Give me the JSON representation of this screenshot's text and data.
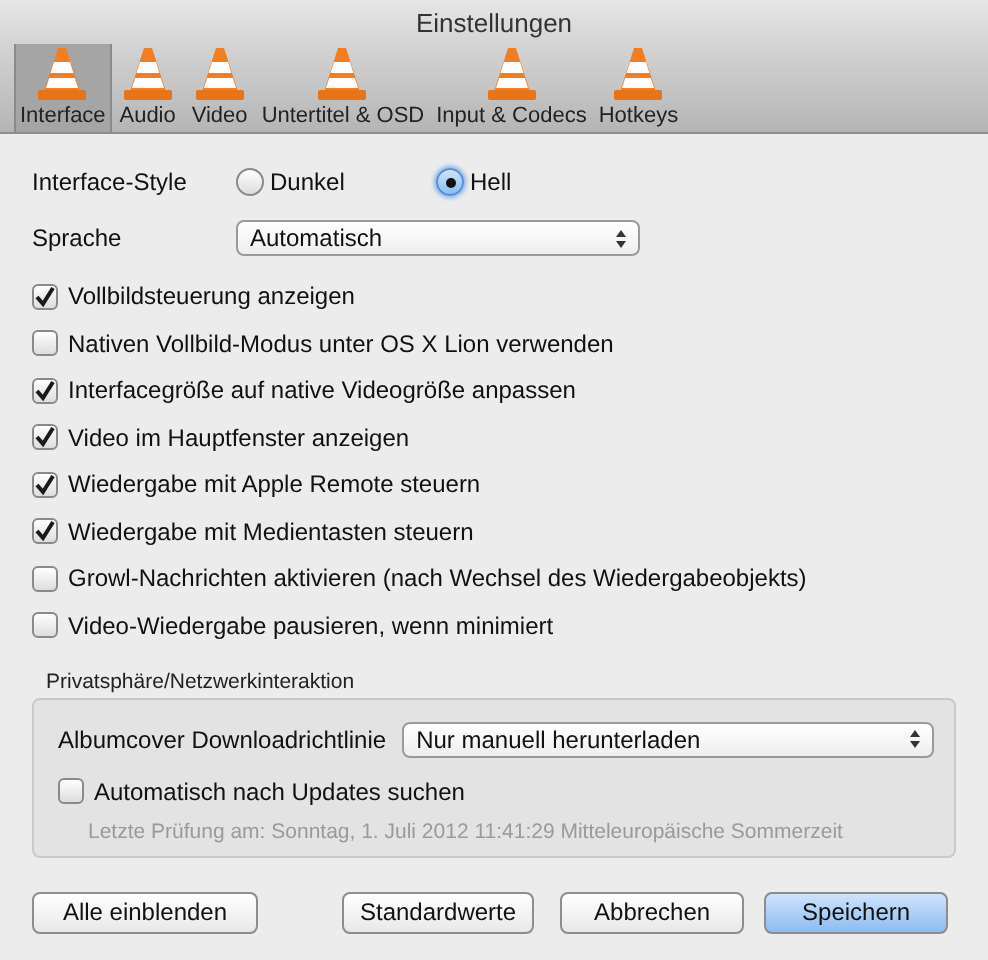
{
  "window": {
    "title": "Einstellungen"
  },
  "tabs": [
    {
      "label": "Interface",
      "selected": true
    },
    {
      "label": "Audio",
      "selected": false
    },
    {
      "label": "Video",
      "selected": false
    },
    {
      "label": "Untertitel & OSD",
      "selected": false
    },
    {
      "label": "Input & Codecs",
      "selected": false
    },
    {
      "label": "Hotkeys",
      "selected": false
    }
  ],
  "interface_style": {
    "label": "Interface-Style",
    "options": [
      {
        "label": "Dunkel",
        "selected": false
      },
      {
        "label": "Hell",
        "selected": true
      }
    ]
  },
  "language": {
    "label": "Sprache",
    "value": "Automatisch"
  },
  "options": [
    {
      "label": "Vollbildsteuerung anzeigen",
      "checked": true
    },
    {
      "label": "Nativen Vollbild-Modus unter OS X Lion verwenden",
      "checked": false
    },
    {
      "label": "Interfacegröße auf native Videogröße anpassen",
      "checked": true
    },
    {
      "label": "Video im Hauptfenster anzeigen",
      "checked": true
    },
    {
      "label": "Wiedergabe mit Apple Remote steuern",
      "checked": true
    },
    {
      "label": "Wiedergabe mit Medientasten steuern",
      "checked": true
    },
    {
      "label": "Growl-Nachrichten aktivieren (nach Wechsel des Wiedergabeobjekts)",
      "checked": false
    },
    {
      "label": "Video-Wiedergabe pausieren, wenn minimiert",
      "checked": false
    }
  ],
  "privacy": {
    "title": "Privatsphäre/Netzwerkinteraktion",
    "artwork_label": "Albumcover Downloadrichtlinie",
    "artwork_value": "Nur manuell herunterladen",
    "updates": {
      "label": "Automatisch nach Updates suchen",
      "checked": false
    },
    "last_check": "Letzte Prüfung am: Sonntag, 1. Juli 2012 11:41:29 Mitteleuropäische Sommerzeit"
  },
  "buttons": [
    {
      "label": "Alle einblenden",
      "kind": "normal"
    },
    {
      "label": "Standardwerte",
      "kind": "normal"
    },
    {
      "label": "Abbrechen",
      "kind": "normal"
    },
    {
      "label": "Speichern",
      "kind": "default"
    }
  ]
}
